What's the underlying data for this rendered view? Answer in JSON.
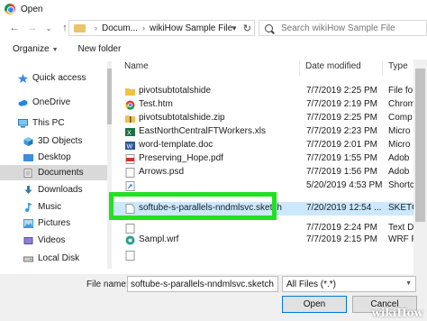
{
  "window": {
    "title": "Open"
  },
  "address": {
    "crumbs": [
      "Docum...",
      "wikiHow Sample File"
    ],
    "search_placeholder": "Search wikiHow Sample File"
  },
  "toolbar": {
    "organize": "Organize",
    "new_folder": "New folder"
  },
  "sidebar": {
    "items": [
      {
        "label": "Quick access",
        "icon": "star-icon"
      },
      {
        "label": "OneDrive",
        "icon": "cloud-icon"
      },
      {
        "label": "This PC",
        "icon": "computer-icon"
      },
      {
        "label": "3D Objects",
        "icon": "cube-icon"
      },
      {
        "label": "Desktop",
        "icon": "desktop-icon"
      },
      {
        "label": "Documents",
        "icon": "documents-icon"
      },
      {
        "label": "Downloads",
        "icon": "download-icon"
      },
      {
        "label": "Music",
        "icon": "music-icon"
      },
      {
        "label": "Pictures",
        "icon": "pictures-icon"
      },
      {
        "label": "Videos",
        "icon": "videos-icon"
      },
      {
        "label": "Local Disk",
        "icon": "disk-icon"
      }
    ]
  },
  "filelist": {
    "columns": {
      "name": "Name",
      "date": "Date modified",
      "type": "Type"
    },
    "rows": [
      {
        "name": "pivotsubtotalshide",
        "date": "7/7/2019 2:25 PM",
        "type": "File fo",
        "icon": "folder-icon"
      },
      {
        "name": "Test.htm",
        "date": "7/7/2019 2:19 PM",
        "type": "Chrom",
        "icon": "chrome-icon"
      },
      {
        "name": "pivotsubtotalshide.zip",
        "date": "7/7/2019 2:25 PM",
        "type": "Comp",
        "icon": "zip-folder-icon"
      },
      {
        "name": "EastNorthCentralFTWorkers.xls",
        "date": "7/7/2019 2:23 PM",
        "type": "Micro",
        "icon": "excel-icon"
      },
      {
        "name": "word-template.doc",
        "date": "7/7/2019 2:01 PM",
        "type": "Micro",
        "icon": "word-icon"
      },
      {
        "name": "Preserving_Hope.pdf",
        "date": "7/7/2019 1:55 PM",
        "type": "Adob",
        "icon": "pdf-icon"
      },
      {
        "name": "Arrows.psd",
        "date": "7/7/2019 1:56 PM",
        "type": "Adob",
        "icon": "psd-icon"
      },
      {
        "name": "",
        "date": "5/20/2019 4:53 PM",
        "type": "Shortc",
        "icon": "shortcut-icon"
      },
      {
        "name": "softube-s-parallels-nndmlsvc.sketch",
        "date": "7/20/2019 12:54 ...",
        "type": "SKETCH",
        "icon": "sketch-file-icon"
      },
      {
        "name": "",
        "date": "7/7/2019 2:24 PM",
        "type": "Text D",
        "icon": "text-file-icon"
      },
      {
        "name": "Sampl.wrf",
        "date": "7/7/2019 2:15 PM",
        "type": "WRF File",
        "icon": "wrf-file-icon"
      },
      {
        "name": "",
        "date": "",
        "type": "",
        "icon": "file-icon"
      }
    ]
  },
  "footer": {
    "file_name_label": "File name:",
    "file_name_value": "softube-s-parallels-nndmlsvc.sketch",
    "file_type_value": "All Files (*.*)",
    "open_label": "Open",
    "cancel_label": "Cancel"
  },
  "watermark": "wikiHow",
  "colors": {
    "selection": "#cce8ff",
    "highlight": "#22e022",
    "sidebar_selected": "#d9d9d9"
  }
}
